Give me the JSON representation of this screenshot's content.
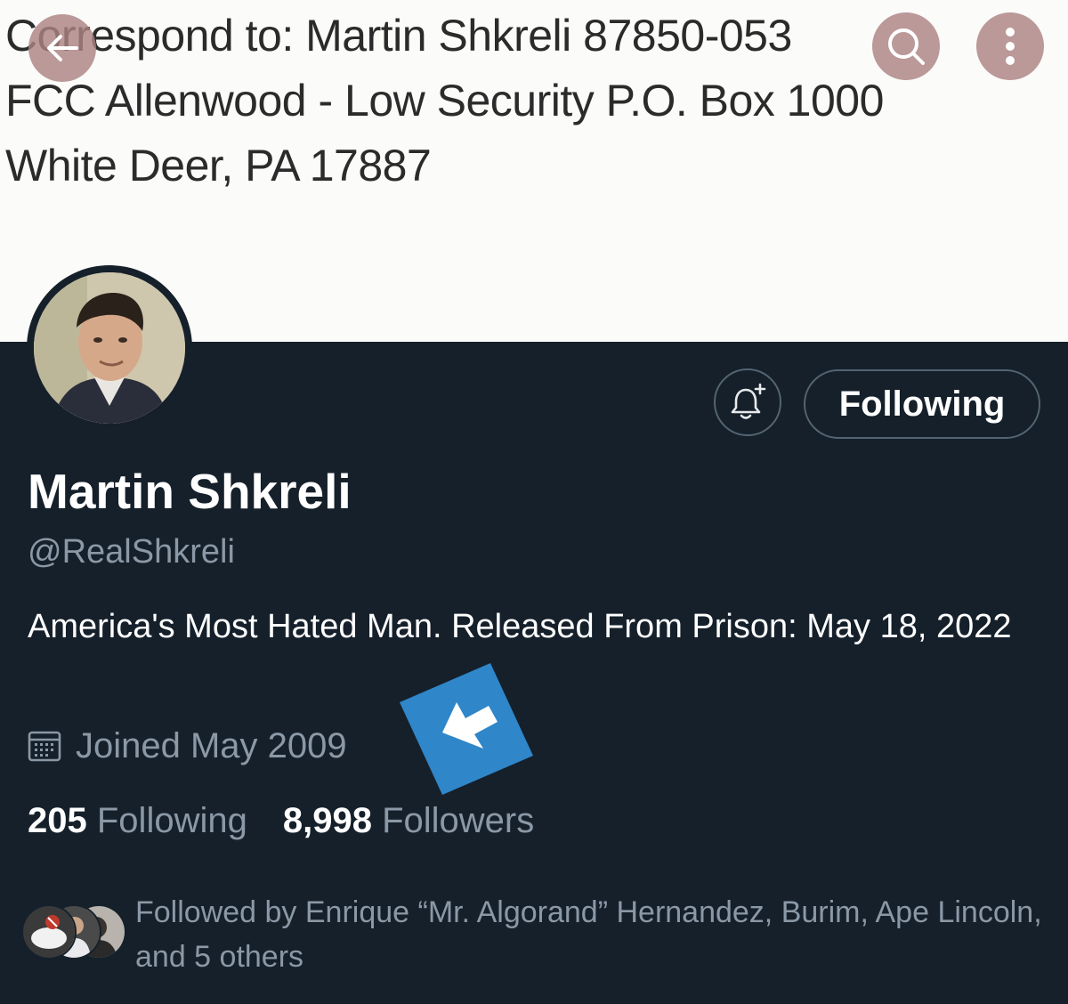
{
  "banner": {
    "lines": [
      "Correspond to: Martin Shkreli 87850-053",
      "FCC Allenwood - Low Security P.O. Box 1000",
      "White Deer, PA 17887"
    ]
  },
  "nav": {
    "back_icon": "arrow-left-icon",
    "search_icon": "search-icon",
    "more_icon": "more-vertical-icon"
  },
  "profile": {
    "name": "Martin Shkreli",
    "handle": "@RealShkreli",
    "bio": "America's Most Hated Man.  Released From Prison: May 18, 2022",
    "joined": "Joined May 2009",
    "following_count": "205",
    "following_label": "Following",
    "followers_count": "8,998",
    "followers_label": "Followers",
    "followed_by": "Followed by Enrique “Mr. Algorand” Hernandez, Burim, Ape Lincoln, and 5 others"
  },
  "actions": {
    "notify_icon": "bell-plus-icon",
    "follow_label": "Following"
  },
  "colors": {
    "background": "#15202b",
    "muted_text": "#8b98a5",
    "border": "#536471",
    "overlay_button": "#ab8282",
    "pointer_blue": "#2f86c9"
  }
}
